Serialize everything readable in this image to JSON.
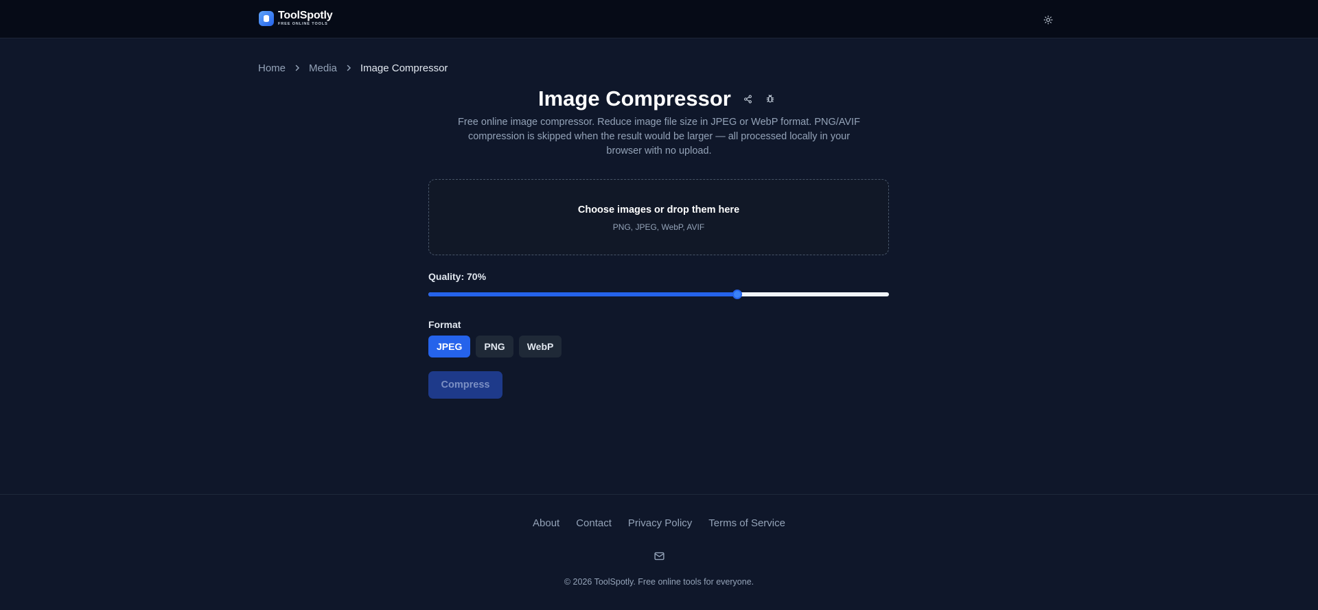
{
  "header": {
    "logo_name": "ToolSpotly",
    "logo_tagline": "FREE ONLINE TOOLS",
    "logo_icon": "toolspotly-logo-icon",
    "theme_icon": "sun-icon"
  },
  "breadcrumb": {
    "items": [
      "Home",
      "Media"
    ],
    "current": "Image Compressor",
    "separator_icon": "chevron-right-icon"
  },
  "page": {
    "title": "Image Compressor",
    "share_icon": "share-icon",
    "report_icon": "bug-icon",
    "description": "Free online image compressor. Reduce image file size in JPEG or WebP format. PNG/AVIF compression is skipped when the result would be larger — all processed locally in your browser with no upload."
  },
  "dropzone": {
    "title": "Choose images or drop them here",
    "formats": "PNG, JPEG, WebP, AVIF"
  },
  "quality": {
    "label": "Quality: 70%",
    "value": 0.67
  },
  "format": {
    "label": "Format",
    "options": [
      "JPEG",
      "PNG",
      "WebP"
    ],
    "selected": "JPEG"
  },
  "actions": {
    "compress_label": "Compress"
  },
  "footer": {
    "links": [
      "About",
      "Contact",
      "Privacy Policy",
      "Terms of Service"
    ],
    "mail_icon": "mail-icon",
    "copyright": "© 2026 ToolSpotly. Free online tools for everyone."
  },
  "colors": {
    "background": "#0f172a",
    "header_background": "#060b17",
    "accent": "#2563eb",
    "text_muted": "#94a3b8"
  }
}
